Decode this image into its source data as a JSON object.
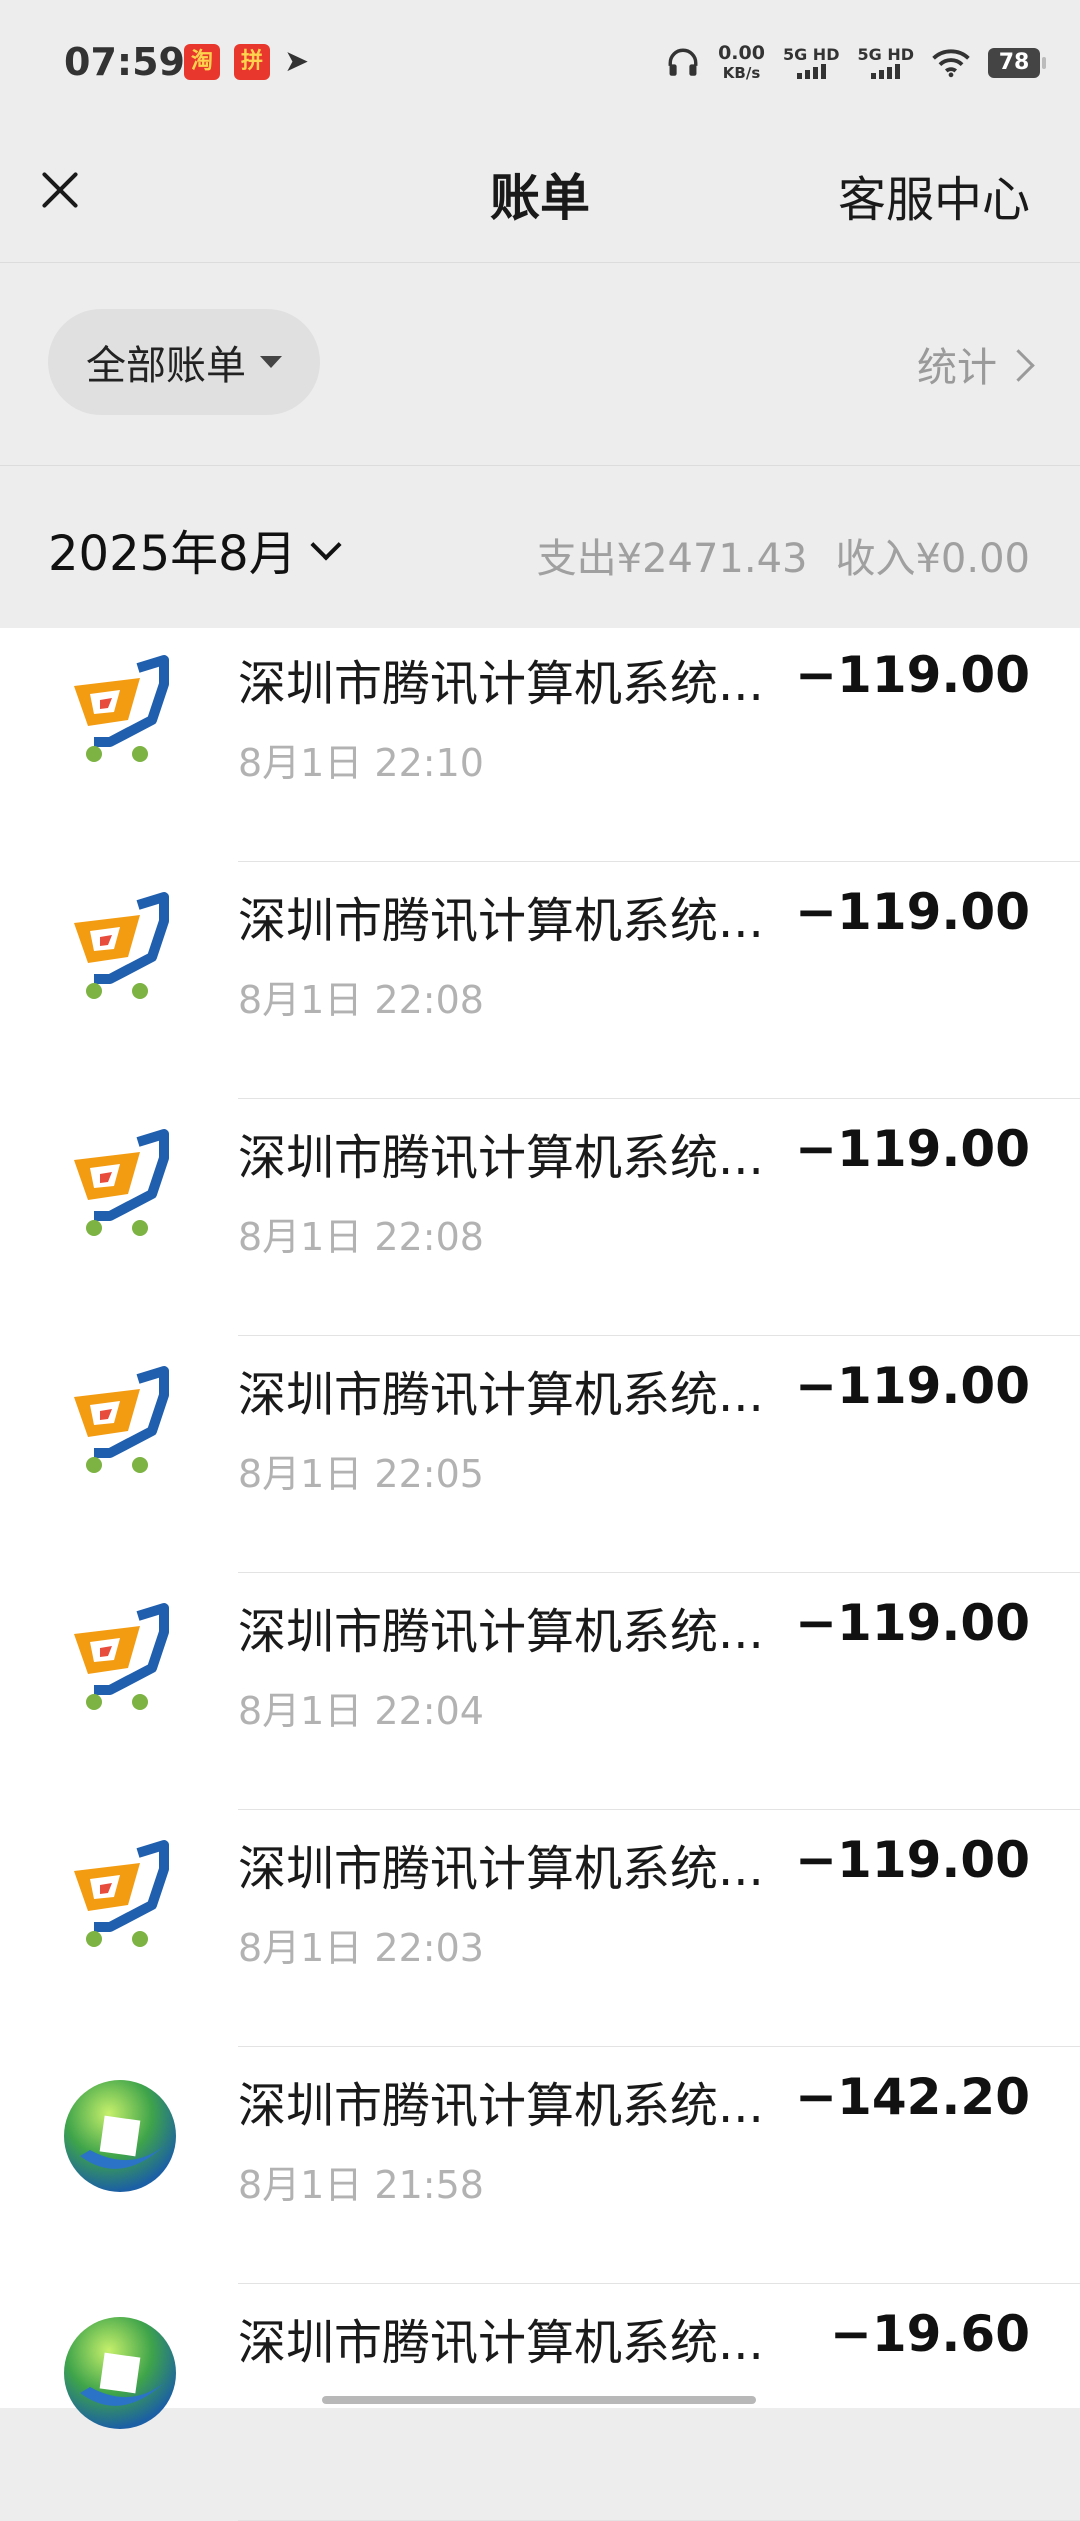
{
  "status": {
    "time": "07:59",
    "app1": "淘",
    "app2": "拼",
    "speed_value": "0.00",
    "speed_unit": "KB/s",
    "sim1": "5G HD",
    "sim2": "5G HD",
    "battery": "78"
  },
  "header": {
    "title": "账单",
    "service": "客服中心"
  },
  "filter": {
    "all_bills": "全部账单",
    "stats": "统计"
  },
  "month": {
    "label": "2025年8月",
    "expense": "支出¥2471.43",
    "income": "收入¥0.00"
  },
  "transactions": [
    {
      "name": "深圳市腾讯计算机系统...",
      "time": "8月1日 22:10",
      "amount": "−119.00",
      "icon": "cart-icon"
    },
    {
      "name": "深圳市腾讯计算机系统...",
      "time": "8月1日 22:08",
      "amount": "−119.00",
      "icon": "cart-icon"
    },
    {
      "name": "深圳市腾讯计算机系统...",
      "time": "8月1日 22:08",
      "amount": "−119.00",
      "icon": "cart-icon"
    },
    {
      "name": "深圳市腾讯计算机系统...",
      "time": "8月1日 22:05",
      "amount": "−119.00",
      "icon": "cart-icon"
    },
    {
      "name": "深圳市腾讯计算机系统...",
      "time": "8月1日 22:04",
      "amount": "−119.00",
      "icon": "cart-icon"
    },
    {
      "name": "深圳市腾讯计算机系统...",
      "time": "8月1日 22:03",
      "amount": "−119.00",
      "icon": "cart-icon"
    },
    {
      "name": "深圳市腾讯计算机系统...",
      "time": "8月1日 21:58",
      "amount": "−142.20",
      "icon": "globe-icon"
    },
    {
      "name": "深圳市腾讯计算机系统...",
      "time": "",
      "amount": "−19.60",
      "icon": "globe-icon"
    }
  ]
}
